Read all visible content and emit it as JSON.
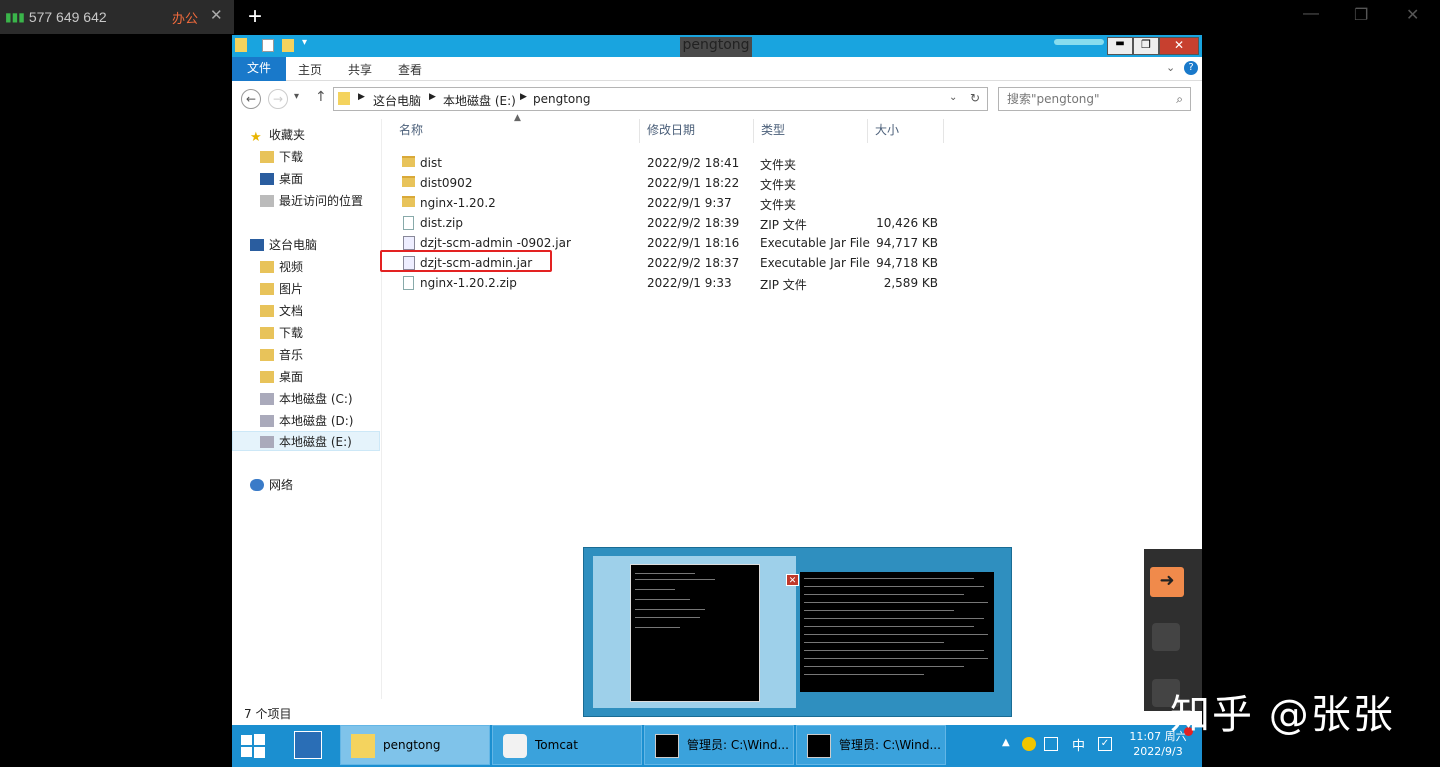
{
  "client": {
    "connection_id": "577 649 642",
    "connection_name": "办公",
    "close": "✕",
    "add": "+"
  },
  "window": {
    "title": "pengtong"
  },
  "ribbon": {
    "tabs": [
      "文件",
      "主页",
      "共享",
      "查看"
    ]
  },
  "address": {
    "crumbs": [
      "这台电脑",
      "本地磁盘 (E:)",
      "pengtong"
    ],
    "search_placeholder": "搜索\"pengtong\""
  },
  "nav": {
    "favorites": "收藏夹",
    "favorites_items": [
      "下载",
      "桌面",
      "最近访问的位置"
    ],
    "this_pc": "这台电脑",
    "pc_items": [
      "视频",
      "图片",
      "文档",
      "下载",
      "音乐",
      "桌面",
      "本地磁盘 (C:)",
      "本地磁盘 (D:)",
      "本地磁盘 (E:)"
    ],
    "network": "网络"
  },
  "columns": [
    "名称",
    "修改日期",
    "类型",
    "大小"
  ],
  "files": [
    {
      "name": "dist",
      "date": "2022/9/2 18:41",
      "type": "文件夹",
      "size": "",
      "kind": "folder"
    },
    {
      "name": "dist0902",
      "date": "2022/9/1 18:22",
      "type": "文件夹",
      "size": "",
      "kind": "folder"
    },
    {
      "name": "nginx-1.20.2",
      "date": "2022/9/1 9:37",
      "type": "文件夹",
      "size": "",
      "kind": "folder"
    },
    {
      "name": "dist.zip",
      "date": "2022/9/2 18:39",
      "type": "ZIP 文件",
      "size": "10,426 KB",
      "kind": "zip"
    },
    {
      "name": "dzjt-scm-admin -0902.jar",
      "date": "2022/9/1 18:16",
      "type": "Executable Jar File",
      "size": "94,717 KB",
      "kind": "jar"
    },
    {
      "name": "dzjt-scm-admin.jar",
      "date": "2022/9/2 18:37",
      "type": "Executable Jar File",
      "size": "94,718 KB",
      "kind": "jar"
    },
    {
      "name": "nginx-1.20.2.zip",
      "date": "2022/9/1 9:33",
      "type": "ZIP 文件",
      "size": "2,589 KB",
      "kind": "zip"
    }
  ],
  "status": "7 个项目",
  "taskbar": {
    "items": [
      "pengtong",
      "Tomcat",
      "管理员: C:\\Wind...",
      "管理员: C:\\Wind..."
    ],
    "clock_time": "11:07 周六",
    "clock_date": "2022/9/3",
    "ime": "中"
  },
  "watermark": "知乎 @张张",
  "colors": {
    "accent": "#1979ca",
    "titlebar": "#19a4df",
    "highlight": "#e32222",
    "taskbar": "#1b8fd0"
  }
}
